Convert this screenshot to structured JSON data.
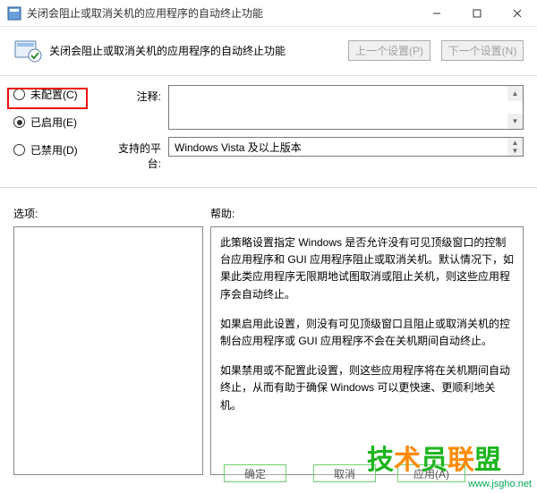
{
  "window": {
    "title": "关闭会阻止或取消关机的应用程序的自动终止功能",
    "min_tooltip": "最小化",
    "max_tooltip": "最大化",
    "close_tooltip": "关闭"
  },
  "header": {
    "title": "关闭会阻止或取消关机的应用程序的自动终止功能",
    "prev_btn": "上一个设置(P)",
    "next_btn": "下一个设置(N)"
  },
  "radios": {
    "not_configured": "未配置(C)",
    "enabled": "已启用(E)",
    "disabled": "已禁用(D)",
    "selected": "enabled"
  },
  "fields": {
    "comment_label": "注释:",
    "comment_value": "",
    "platform_label": "支持的平台:",
    "platform_value": "Windows Vista 及以上版本"
  },
  "labels": {
    "options": "选项:",
    "help": "帮助:"
  },
  "help": {
    "p1": "此策略设置指定 Windows 是否允许没有可见顶级窗口的控制台应用程序和 GUI 应用程序阻止或取消关机。默认情况下，如果此类应用程序无限期地试图取消或阻止关机，则这些应用程序会自动终止。",
    "p2": "如果启用此设置，则没有可见顶级窗口且阻止或取消关机的控制台应用程序或 GUI 应用程序不会在关机期间自动终止。",
    "p3": "如果禁用或不配置此设置，则这些应用程序将在关机期间自动终止，从而有助于确保 Windows 可以更快速、更顺利地关机。"
  },
  "buttons": {
    "ok": "确定",
    "cancel": "取消",
    "apply": "应用(A)"
  },
  "watermark": {
    "text": "技术员联盟",
    "link": "www.jsgho.net"
  }
}
